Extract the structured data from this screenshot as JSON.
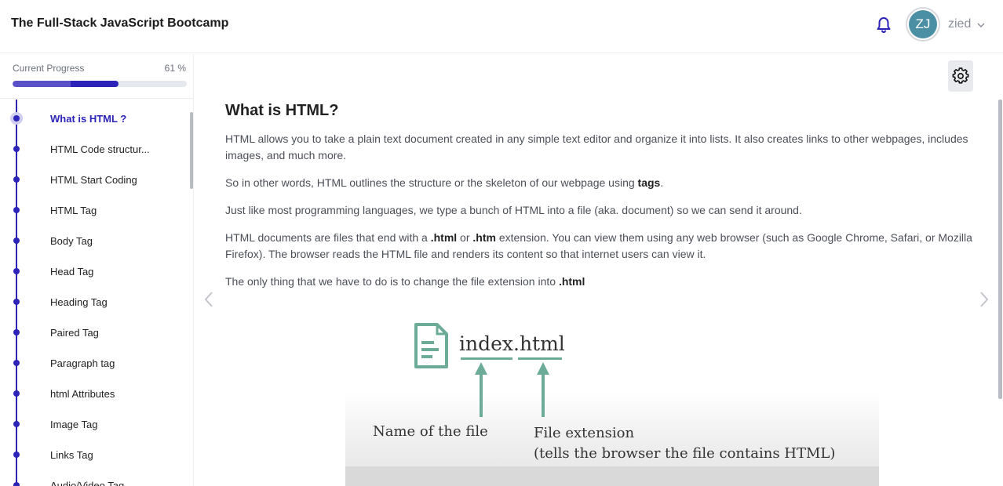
{
  "header": {
    "app_title": "The Full-Stack JavaScript Bootcamp",
    "avatar_initials": "ZJ",
    "username": "zied"
  },
  "sidebar": {
    "progress_label": "Current Progress",
    "progress_value": "61 %",
    "progress_fraction": 0.61,
    "lessons": [
      {
        "label": "What is HTML ?",
        "active": true
      },
      {
        "label": "HTML Code structur..."
      },
      {
        "label": "HTML Start Coding"
      },
      {
        "label": "HTML Tag"
      },
      {
        "label": "Body Tag"
      },
      {
        "label": "Head Tag"
      },
      {
        "label": "Heading Tag"
      },
      {
        "label": "Paired Tag"
      },
      {
        "label": "Paragraph tag"
      },
      {
        "label": "html Attributes"
      },
      {
        "label": "Image Tag"
      },
      {
        "label": "Links Tag"
      },
      {
        "label": "Audio/Video Tag"
      }
    ]
  },
  "main": {
    "title": "What is HTML?",
    "p1": "HTML allows you to take a plain text document created in any simple text editor and organize it into lists. It also creates links to other webpages, includes images, and much more.",
    "p2_before": "So in other words, HTML outlines the structure or the skeleton of our webpage using ",
    "p2_bold": "tags",
    "p2_after": ".",
    "p3": "Just like most programming languages, we type a bunch of HTML into a file (aka. document) so we can send it around.",
    "p4_a": "HTML documents are files that end with a ",
    "p4_b": ".html",
    "p4_c": " or ",
    "p4_d": ".htm",
    "p4_e": " extension. You can view them using any web browser (such as Google Chrome, Safari, or Mozilla Firefox). The browser reads the HTML file and renders its content so that internet users can view it.",
    "p5_before": "The only thing that we have to do is to change the file extension into ",
    "p5_bold": ".html"
  },
  "figure": {
    "filename": "index.html",
    "caption_name": "Name of the file",
    "caption_ext_line1": "File extension",
    "caption_ext_line2": "(tells the browser the file contains HTML)"
  },
  "colors": {
    "accent": "#2c23b8",
    "accent_light": "#5a51c9",
    "figure_green": "#6cab97",
    "avatar_bg": "#4a8fa4"
  },
  "icons": {
    "bell": "bell-icon",
    "settings": "gear-icon",
    "prev": "chevron-left-icon",
    "next": "chevron-right-icon",
    "user_menu": "chevron-down-icon",
    "file": "document-icon"
  }
}
